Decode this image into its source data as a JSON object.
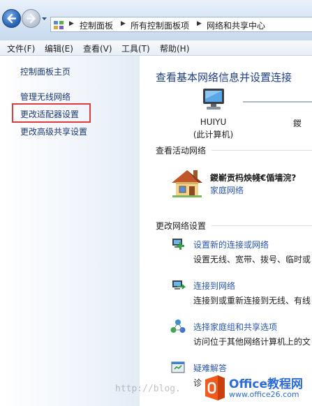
{
  "breadcrumb": {
    "items": [
      "控制面板",
      "所有控制面板项",
      "网络和共享中心"
    ]
  },
  "menu": {
    "items": [
      "文件(F)",
      "编辑(E)",
      "查看(V)",
      "工具(T)",
      "帮助(H)"
    ]
  },
  "sidebar": {
    "links": [
      "控制面板主页",
      "管理无线网络",
      "更改适配器设置",
      "更改高级共享设置"
    ],
    "highlighted_index": 2,
    "highlight_color": "#e23b3b"
  },
  "main": {
    "heading": "查看基本网络信息并设置连接",
    "computer": {
      "name": "HUIYU",
      "caption": "(此计算机)"
    },
    "internet_label": "鍐",
    "active_networks_title": "查看活动网络",
    "active_network": {
      "name": "鍐嶄贡杩炴帴€偱墙浣?",
      "type": "家庭网络"
    },
    "change_settings_title": "更改网络设置",
    "tasks": [
      {
        "icon": "new-connection-icon",
        "link": "设置新的连接或网络",
        "desc": "设置无线、宽带、拨号、临时或"
      },
      {
        "icon": "connect-network-icon",
        "link": "连接到网络",
        "desc": "连接到或重新连接到无线、有线"
      },
      {
        "icon": "homegroup-icon",
        "link": "选择家庭组和共享选项",
        "desc": "访问位于其他网络计算机上的文"
      },
      {
        "icon": "troubleshoot-icon",
        "link": "疑难解答",
        "desc": "诊"
      }
    ]
  },
  "watermark": {
    "blog": "http://blog.",
    "office_title": "Office教程网",
    "office_url": "www.office26.com"
  },
  "colors": {
    "link": "#2a56b0",
    "heading": "#1e3e8c",
    "sidebar_link": "#1c3a72"
  }
}
